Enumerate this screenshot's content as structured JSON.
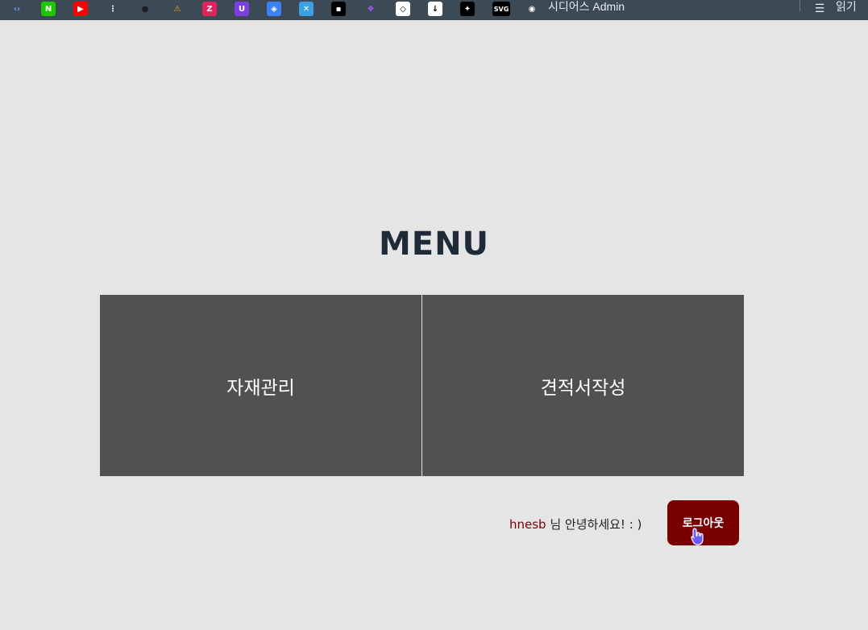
{
  "bookmarks": {
    "items": [
      {
        "icon": "code-icon",
        "glyph": "‹›",
        "color": "#3c4a55",
        "fg": "#6fa8ff"
      },
      {
        "icon": "naver-icon",
        "glyph": "N",
        "color": "#1ec800",
        "fg": "#ffffff"
      },
      {
        "icon": "youtube-icon",
        "glyph": "▶",
        "color": "#ff0000",
        "fg": "#ffffff"
      },
      {
        "icon": "dots-icon",
        "glyph": "⋮",
        "color": "#3c4a55",
        "fg": "#ffffff"
      },
      {
        "icon": "github-icon",
        "glyph": "●",
        "color": "#3c4a55",
        "fg": "#1b1f23"
      },
      {
        "icon": "triangle-icon",
        "glyph": "⚠",
        "color": "#3c4a55",
        "fg": "#f5a623"
      },
      {
        "icon": "z-icon",
        "glyph": "Z",
        "color": "#e0245e",
        "fg": "#ffffff"
      },
      {
        "icon": "shield-u-icon",
        "glyph": "U",
        "color": "#7b3fe4",
        "fg": "#ffffff"
      },
      {
        "icon": "layers-icon",
        "glyph": "◈",
        "color": "#3b82f6",
        "fg": "#ffffff"
      },
      {
        "icon": "x-tool-icon",
        "glyph": "✕",
        "color": "#3ba0e6",
        "fg": "#ffffff"
      },
      {
        "icon": "unsplash-icon",
        "glyph": "▪",
        "color": "#000000",
        "fg": "#ffffff"
      },
      {
        "icon": "figma-icon",
        "glyph": "❖",
        "color": "#3c4a55",
        "fg": "#a259ff"
      },
      {
        "icon": "codepen-icon",
        "glyph": "◇",
        "color": "#ffffff",
        "fg": "#000000"
      },
      {
        "icon": "download-icon",
        "glyph": "↓",
        "color": "#ffffff",
        "fg": "#000000"
      },
      {
        "icon": "puzzle-icon",
        "glyph": "✦",
        "color": "#000000",
        "fg": "#ffffff"
      },
      {
        "icon": "svg-icon",
        "glyph": "SVG",
        "color": "#000000",
        "fg": "#ffffff"
      },
      {
        "icon": "globe-icon",
        "glyph": "◉",
        "color": "#3c4a55",
        "fg": "#ffffff"
      }
    ],
    "admin_label": "시디어스 Admin",
    "reading_list_label": "읽기"
  },
  "main": {
    "title": "MENU",
    "tiles": [
      {
        "label": "자재관리"
      },
      {
        "label": "견적서작성"
      }
    ],
    "greeting": {
      "user": "hnesb",
      "message": " 님 안녕하세요! : )"
    },
    "logout_label": "로그아웃"
  },
  "colors": {
    "background": "#e5e5e5",
    "tile": "#515151",
    "accent": "#7a0000",
    "title": "#1f2a38"
  }
}
